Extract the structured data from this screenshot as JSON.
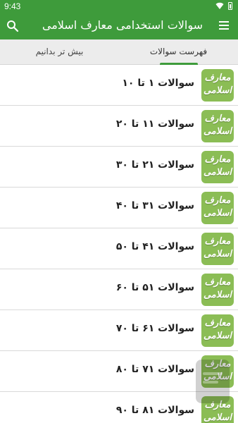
{
  "status_bar": {
    "time": "9:43",
    "icons": [
      "wifi-icon",
      "battery-icon"
    ]
  },
  "app_bar": {
    "title": "سوالات استخدامی معارف اسلامی",
    "menu_icon": "menu-icon",
    "search_icon": "search-icon"
  },
  "tabs": [
    {
      "label": "فهرست سوالات",
      "active": true
    },
    {
      "label": "بیش تر بدانیم",
      "active": false
    }
  ],
  "items": [
    {
      "label": "سوالات ۱ تا ۱۰"
    },
    {
      "label": "سوالات ۱۱ تا ۲۰"
    },
    {
      "label": "سوالات ۲۱ تا ۳۰"
    },
    {
      "label": "سوالات ۳۱ تا ۴۰"
    },
    {
      "label": "سوالات ۴۱ تا ۵۰"
    },
    {
      "label": "سوالات ۵۱ تا ۶۰"
    },
    {
      "label": "سوالات ۶۱ تا ۷۰"
    },
    {
      "label": "سوالات ۷۱ تا ۸۰"
    },
    {
      "label": "سوالات ۸۱ تا ۹۰"
    }
  ],
  "thumbnail": {
    "line1": "معارف",
    "line2": "اسلامی"
  },
  "colors": {
    "primary": "#3e9b3b",
    "thumb_bg": "#8bbd55"
  }
}
